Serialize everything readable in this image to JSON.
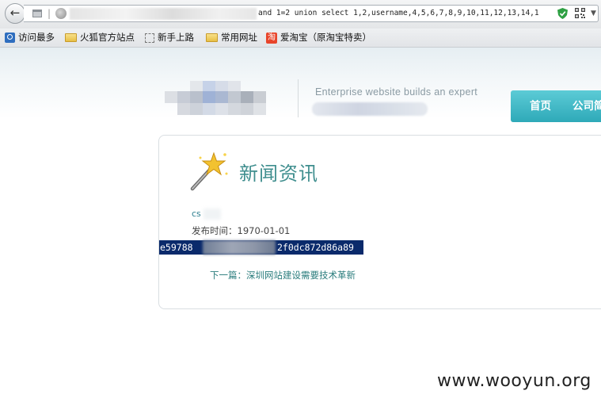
{
  "browser": {
    "url_tail": "and 1=2 union select 1,2,username,4,5,6,7,8,9,10,11,12,13,14,1",
    "icons": [
      "back-arrow-icon",
      "page-icon",
      "globe-icon",
      "shield-icon",
      "qr-code-icon"
    ]
  },
  "bookmarks": [
    {
      "label": "访问最多",
      "icon": "search-icon"
    },
    {
      "label": "火狐官方站点",
      "icon": "folder-icon"
    },
    {
      "label": "新手上路",
      "icon": "dashed-page-icon"
    },
    {
      "label": "常用网址",
      "icon": "folder-icon"
    },
    {
      "label": "爱淘宝（原淘宝特卖）",
      "icon": "tao-icon"
    }
  ],
  "header": {
    "slogan": "Enterprise website builds an expert",
    "nav": [
      {
        "label": "首页"
      },
      {
        "label": "公司简介"
      }
    ],
    "nav_color": "#3fb7c4"
  },
  "article": {
    "section_title": "新闻资讯",
    "title_text": "cs",
    "publish_label": "发布时间：",
    "publish_date": "1970-01-01",
    "hash_start": "e59788",
    "hash_end": "2f0dc872d86a89",
    "next_link": "下一篇：深圳网站建设需要技术革新"
  },
  "watermark": "www.wooyun.org"
}
